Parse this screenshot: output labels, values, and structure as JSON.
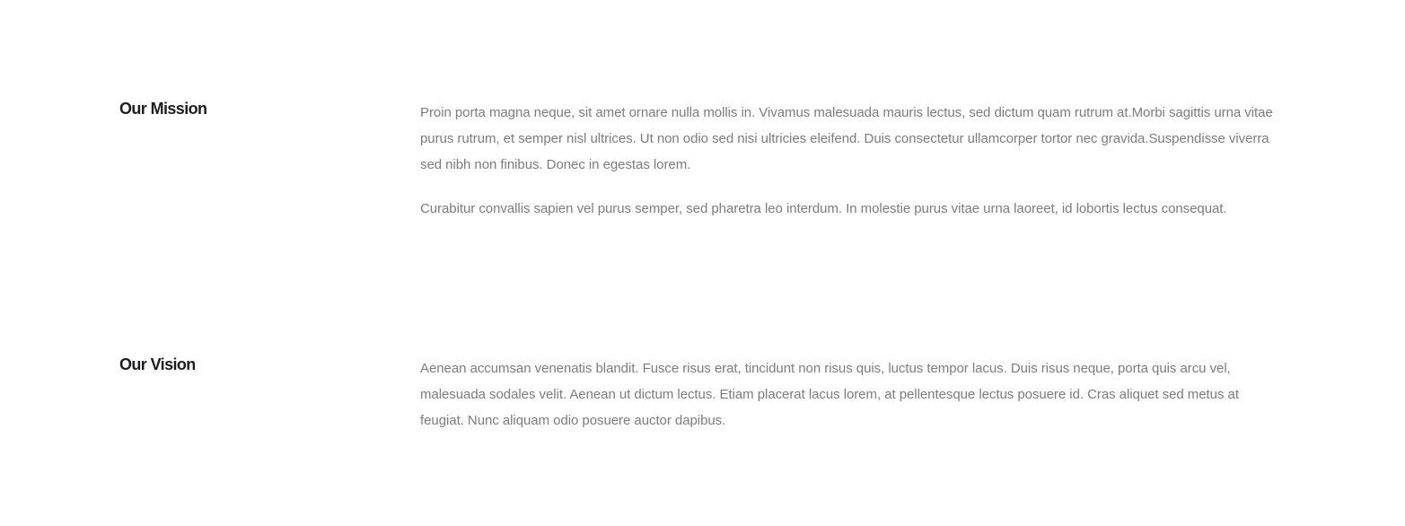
{
  "mission": {
    "title": "Our Mission",
    "paragraphs": [
      "Proin porta magna neque, sit amet ornare nulla mollis in. Vivamus malesuada mauris lectus, sed dictum quam rutrum at.Morbi sagittis urna vitae purus rutrum, et semper nisl ultrices. Ut non odio sed nisi ultricies eleifend. Duis consectetur ullamcorper tortor nec gravida.Suspendisse viverra sed nibh non finibus. Donec in egestas lorem.",
      "Curabitur convallis sapien vel purus semper, sed pharetra leo interdum. In molestie purus vitae urna laoreet, id lobortis lectus consequat."
    ]
  },
  "vision": {
    "title": "Our Vision",
    "paragraphs": [
      "Aenean accumsan venenatis blandit. Fusce risus erat, tincidunt non risus quis, luctus tempor lacus. Duis risus neque, porta quis arcu vel, malesuada sodales velit. Aenean ut dictum lectus. Etiam placerat lacus lorem, at pellentesque lectus posuere id. Cras aliquet sed metus at feugiat. Nunc aliquam odio posuere auctor dapibus."
    ]
  }
}
